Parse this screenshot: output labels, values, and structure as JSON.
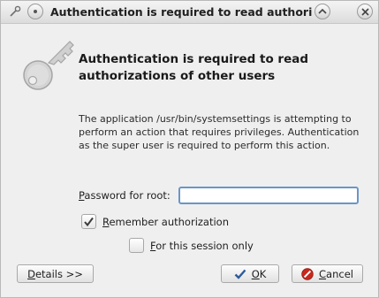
{
  "titlebar": {
    "title": "Authentication is required to read authorization",
    "icons": [
      "wrench-icon",
      "menu-icon",
      "chevron-up-icon",
      "close-icon"
    ]
  },
  "dialog": {
    "headline": "Authentication is required to read authorizations of other users",
    "description": "The application /usr/bin/systemsettings is attempting to perform an action that requires privileges. Authentication as the super user is required to perform this action.",
    "icon": "key-icon"
  },
  "password": {
    "label_mnemonic": "P",
    "label_rest": "assword for root:",
    "value": ""
  },
  "remember": {
    "mnemonic": "R",
    "label_rest": "emember authorization",
    "checked": true
  },
  "session_only": {
    "mnemonic": "F",
    "label_rest": "or this session only",
    "checked": false
  },
  "buttons": {
    "details_mnemonic": "D",
    "details_rest": "etails >>",
    "ok_mnemonic": "O",
    "ok_rest": "K",
    "cancel_mnemonic": "C",
    "cancel_rest": "ancel"
  },
  "colors": {
    "focus_border": "#6a96c8",
    "ok_check": "#2f5a9a",
    "cancel_red": "#c8281e"
  }
}
